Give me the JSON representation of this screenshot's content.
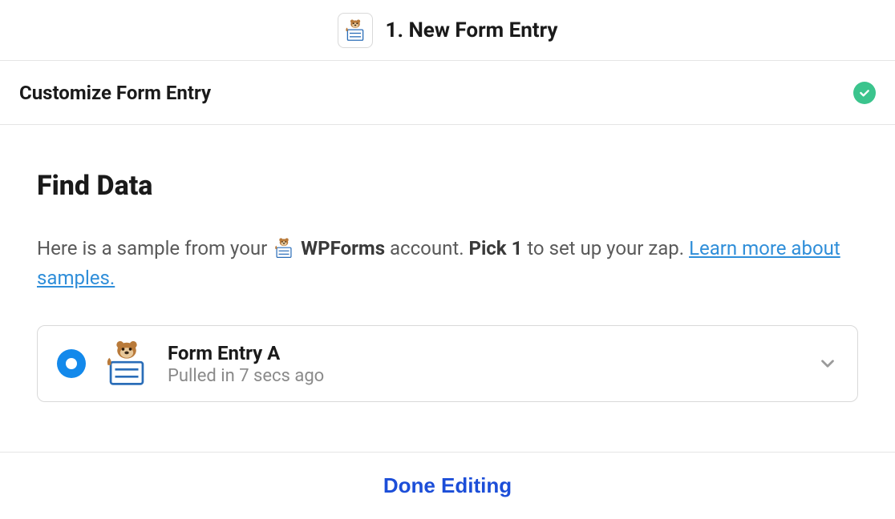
{
  "header": {
    "step_label": "1. New Form Entry"
  },
  "subheader": {
    "title": "Customize Form Entry"
  },
  "find_data": {
    "heading": "Find Data",
    "intro_prefix": "Here is a sample from your ",
    "app_name": "WPForms",
    "intro_mid": " account. ",
    "pick_label": "Pick 1",
    "intro_suffix": " to set up your zap. ",
    "learn_more": "Learn more about samples."
  },
  "sample": {
    "title": "Form Entry A",
    "subtitle": "Pulled in 7 secs ago"
  },
  "footer": {
    "done_label": "Done Editing"
  }
}
